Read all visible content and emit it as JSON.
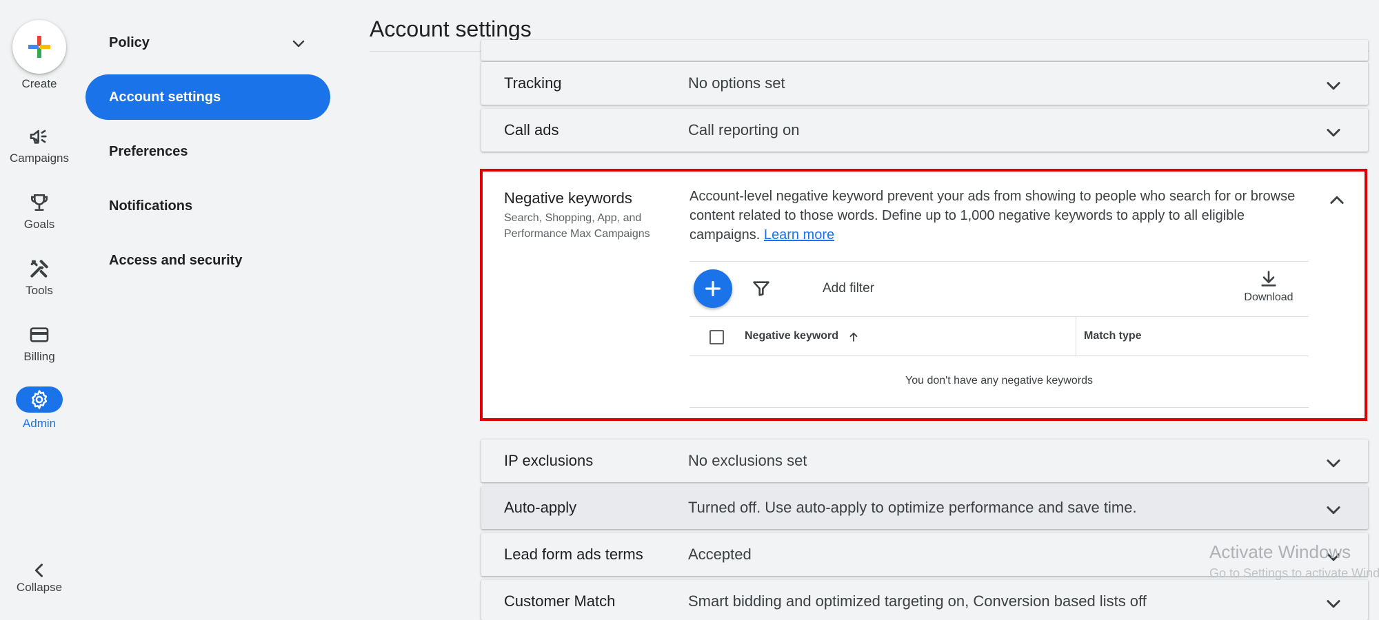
{
  "rail": {
    "create_label": "Create",
    "items": [
      {
        "label": "Campaigns",
        "icon": "megaphone-icon"
      },
      {
        "label": "Goals",
        "icon": "trophy-icon"
      },
      {
        "label": "Tools",
        "icon": "tools-icon"
      },
      {
        "label": "Billing",
        "icon": "credit-card-icon"
      },
      {
        "label": "Admin",
        "icon": "gear-icon"
      }
    ],
    "collapse_label": "Collapse"
  },
  "nav": {
    "items": [
      {
        "label": "Policy"
      },
      {
        "label": "Account settings"
      },
      {
        "label": "Preferences"
      },
      {
        "label": "Notifications"
      },
      {
        "label": "Access and security"
      }
    ]
  },
  "header": {
    "title": "Account settings"
  },
  "rows": [
    {
      "title": "Tracking",
      "value": "No options set"
    },
    {
      "title": "Call ads",
      "value": "Call reporting on"
    },
    {
      "title": "IP exclusions",
      "value": "No exclusions set"
    },
    {
      "title": "Auto-apply",
      "value": "Turned off. Use auto-apply to optimize performance and save time."
    },
    {
      "title": "Lead form ads terms",
      "value": "Accepted"
    },
    {
      "title": "Customer Match",
      "value": "Smart bidding and optimized targeting on, Conversion based lists off"
    }
  ],
  "negative_keywords": {
    "title": "Negative keywords",
    "subtitle": "Search, Shopping, App, and Performance Max Campaigns",
    "description": "Account-level negative keyword prevent your ads from showing to people who search for or browse content related to those words. Define up to 1,000 negative keywords to apply to all eligible campaigns.",
    "learn_more": "Learn more",
    "add_filter": "Add filter",
    "download": "Download",
    "columns": [
      "Negative keyword",
      "Match type"
    ],
    "empty_message": "You don't have any negative keywords"
  },
  "watermark": {
    "line1": "Activate Windows",
    "line2": "Go to Settings to activate Windows."
  },
  "colors": {
    "accent": "#1a73e8",
    "highlight_border": "#e00000",
    "background": "#f1f3f4"
  }
}
